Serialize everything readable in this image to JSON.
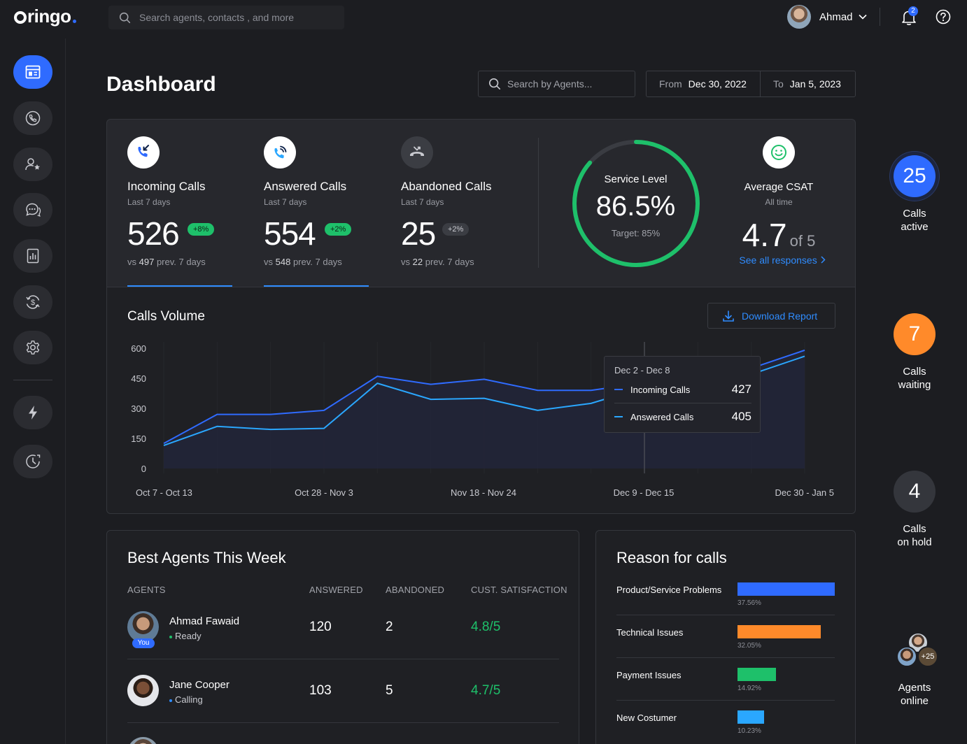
{
  "app": {
    "logo": "ringo"
  },
  "topbar": {
    "search_placeholder": "Search agents, contacts , and more",
    "user_name": "Ahmad",
    "notification_count": "2"
  },
  "sidebar": {
    "items": [
      {
        "icon": "dashboard-icon",
        "active": true
      },
      {
        "icon": "phone-icon"
      },
      {
        "icon": "contacts-star-icon"
      },
      {
        "icon": "chat-icon"
      },
      {
        "icon": "reports-icon"
      },
      {
        "icon": "billing-icon"
      },
      {
        "icon": "settings-icon"
      },
      {
        "icon": "lightning-icon"
      },
      {
        "icon": "support-icon"
      }
    ]
  },
  "header": {
    "title": "Dashboard",
    "agent_search_placeholder": "Search by Agents...",
    "from_label": "From",
    "from_value": "Dec 30, 2022",
    "to_label": "To",
    "to_value": "Jan 5, 2023"
  },
  "stats": {
    "incoming": {
      "title": "Incoming Calls",
      "sub": "Last 7 days",
      "value": "526",
      "badge": "+8%",
      "prev_prefix": "vs",
      "prev_value": "497",
      "prev_suffix": "prev. 7 days"
    },
    "answered": {
      "title": "Answered Calls",
      "sub": "Last 7 days",
      "value": "554",
      "badge": "+2%",
      "prev_prefix": "vs",
      "prev_value": "548",
      "prev_suffix": "prev. 7 days"
    },
    "abandoned": {
      "title": "Abandoned Calls",
      "sub": "Last 7 days",
      "value": "25",
      "badge": "+2%",
      "prev_prefix": "vs",
      "prev_value": "22",
      "prev_suffix": "prev. 7 days"
    },
    "service_level": {
      "label": "Service Level",
      "value": "86.5%",
      "target": "Target: 85%",
      "fraction": 0.865
    },
    "csat": {
      "title": "Average CSAT",
      "sub": "All time",
      "value": "4.7",
      "of": "of 5",
      "link": "See all responses"
    }
  },
  "volume": {
    "title": "Calls Volume",
    "download_label": "Download Report",
    "tooltip": {
      "title": "Dec 2 - Dec 8",
      "rows": [
        {
          "name": "Incoming Calls",
          "value": "427",
          "color": "#2f6bff"
        },
        {
          "name": "Answered Calls",
          "value": "405",
          "color": "#2aa7ff"
        }
      ]
    }
  },
  "chart_data": {
    "type": "line",
    "y_ticks": [
      "600",
      "450",
      "300",
      "150",
      "0"
    ],
    "x_tick_labels": [
      "Oct 7 - Oct 13",
      "Oct 28 - Nov 3",
      "Nov 18 - Nov 24",
      "Dec 9 - Dec 15",
      "Dec 30 - Jan 5"
    ],
    "ylim": [
      0,
      600
    ],
    "series": [
      {
        "name": "Incoming Calls",
        "color": "#2f6bff",
        "values": [
          125,
          270,
          270,
          290,
          460,
          420,
          445,
          390,
          390,
          427,
          400,
          500,
          590
        ]
      },
      {
        "name": "Answered Calls",
        "color": "#2aa7ff",
        "values": [
          115,
          210,
          195,
          200,
          425,
          345,
          350,
          290,
          325,
          405,
          380,
          470,
          560
        ]
      }
    ],
    "highlight_index": 9
  },
  "agents": {
    "title": "Best Agents This Week",
    "columns": [
      "AGENTS",
      "ANSWERED",
      "ABANDONED",
      "CUST. SATISFACTION"
    ],
    "you_tag": "You",
    "rows": [
      {
        "name": "Ahmad Fawaid",
        "status": "Ready",
        "status_color": "#1ec06a",
        "answered": "120",
        "abandoned": "2",
        "satisfaction": "4.8/5"
      },
      {
        "name": "Jane Cooper",
        "status": "Calling",
        "status_color": "#2f8cff",
        "answered": "103",
        "abandoned": "5",
        "satisfaction": "4.7/5"
      }
    ]
  },
  "reasons": {
    "title": "Reason for calls",
    "items": [
      {
        "name": "Product/Service Problems",
        "pct": "37.56%",
        "value": 37.56,
        "color": "#2f6bff"
      },
      {
        "name": "Technical Issues",
        "pct": "32.05%",
        "value": 32.05,
        "color": "#ff8a2a"
      },
      {
        "name": "Payment Issues",
        "pct": "14.92%",
        "value": 14.92,
        "color": "#1ec06a"
      },
      {
        "name": "New Costumer",
        "pct": "10.23%",
        "value": 10.23,
        "color": "#2aa7ff"
      }
    ]
  },
  "right_status": {
    "active": {
      "value": "25",
      "label1": "Calls",
      "label2": "active",
      "color": "#2f6bff"
    },
    "waiting": {
      "value": "7",
      "label1": "Calls",
      "label2": "waiting",
      "color": "#ff8a2a"
    },
    "hold": {
      "value": "4",
      "label1": "Calls",
      "label2": "on hold",
      "color": "#34363c"
    },
    "online": {
      "extra": "+25",
      "label1": "Agents",
      "label2": "online"
    }
  }
}
